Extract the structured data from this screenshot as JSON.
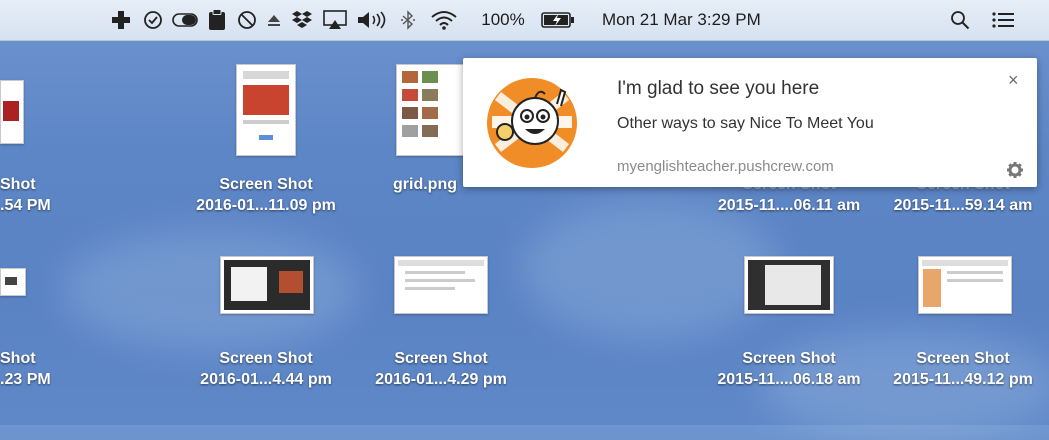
{
  "menubar": {
    "icons": [
      "medical-cross-icon",
      "checkmark-circle-icon",
      "toggle-icon",
      "clipboard-icon",
      "do-not-disturb-icon",
      "eject-icon",
      "dropbox-icon",
      "airplay-icon",
      "volume-icon",
      "bluetooth-icon",
      "wifi-icon"
    ],
    "battery_percent": "100%",
    "battery_icon": "battery-charging-icon",
    "date_time": "Mon 21 Mar  3:29 PM",
    "search_icon": "search-icon",
    "menu_icon": "notification-center-icon"
  },
  "notification": {
    "title": "I'm glad to see you here",
    "body": "Other ways to say Nice To Meet You",
    "domain": "myenglishteacher.pushcrew.com",
    "close_label": "×",
    "gear_icon": "gear-icon"
  },
  "desktop": {
    "row1": [
      {
        "line1": "Shot",
        "line2": ".54 PM"
      },
      {
        "line1": "Screen Shot",
        "line2": "2016-01...11.09 pm"
      },
      {
        "line1": "grid.png",
        "line2": ""
      },
      {
        "line1": "Screen Shot",
        "line2": "2015-11....06.11 am"
      },
      {
        "line1": "Screen Shot",
        "line2": "2015-11...59.14 am"
      }
    ],
    "row2": [
      {
        "line1": "Shot",
        "line2": ".23 PM"
      },
      {
        "line1": "Screen Shot",
        "line2": "2016-01...4.44 pm"
      },
      {
        "line1": "Screen Shot",
        "line2": "2016-01...4.29 pm"
      },
      {
        "line1": "Screen Shot",
        "line2": "2015-11....06.18 am"
      },
      {
        "line1": "Screen Shot",
        "line2": "2015-11...49.12 pm"
      }
    ]
  }
}
